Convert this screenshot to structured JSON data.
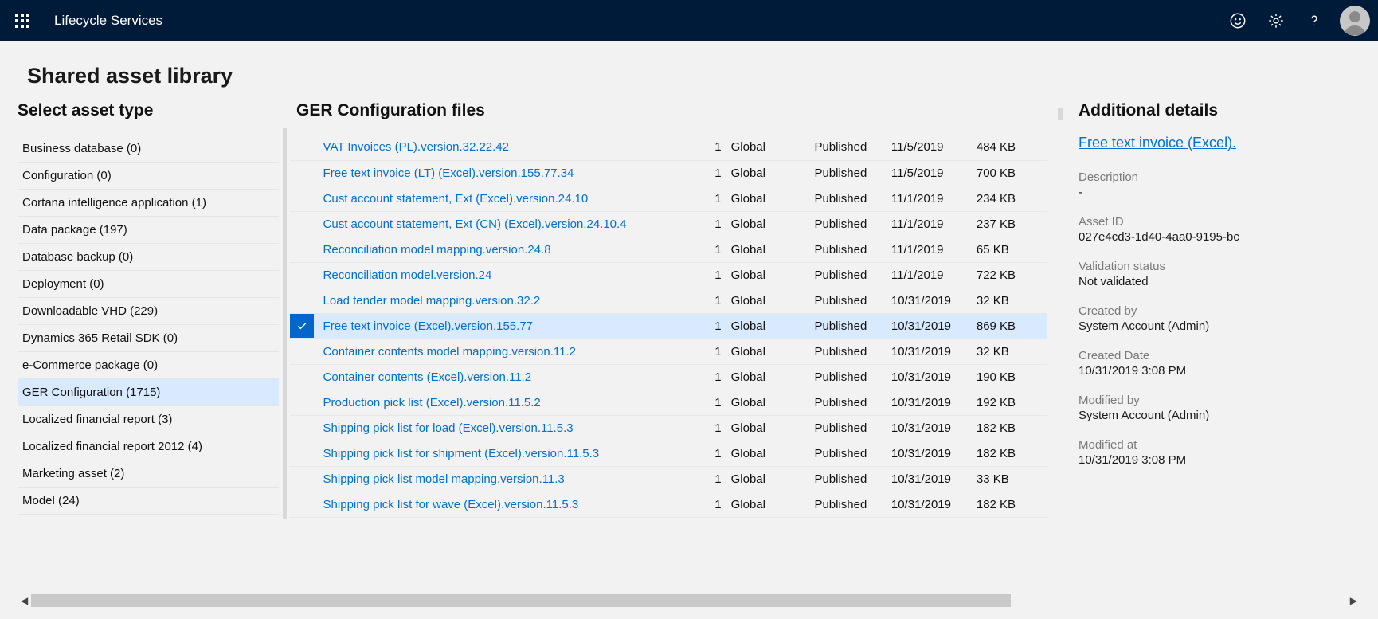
{
  "header": {
    "app_title": "Lifecycle Services"
  },
  "page_title": "Shared asset library",
  "sidebar": {
    "title": "Select asset type",
    "items": [
      {
        "label": "Business database (0)",
        "selected": false
      },
      {
        "label": "Configuration (0)",
        "selected": false
      },
      {
        "label": "Cortana intelligence application (1)",
        "selected": false
      },
      {
        "label": "Data package (197)",
        "selected": false
      },
      {
        "label": "Database backup (0)",
        "selected": false
      },
      {
        "label": "Deployment (0)",
        "selected": false
      },
      {
        "label": "Downloadable VHD (229)",
        "selected": false
      },
      {
        "label": "Dynamics 365 Retail SDK (0)",
        "selected": false
      },
      {
        "label": "e-Commerce package (0)",
        "selected": false
      },
      {
        "label": "GER Configuration (1715)",
        "selected": true
      },
      {
        "label": "Localized financial report (3)",
        "selected": false
      },
      {
        "label": "Localized financial report 2012 (4)",
        "selected": false
      },
      {
        "label": "Marketing asset (2)",
        "selected": false
      },
      {
        "label": "Model (24)",
        "selected": false
      }
    ]
  },
  "main": {
    "title": "GER Configuration files",
    "rows": [
      {
        "name": "VAT Invoices (PL).version.32.22.42",
        "count": "1",
        "scope": "Global",
        "status": "Published",
        "date": "11/5/2019",
        "size": "484 KB",
        "selected": false
      },
      {
        "name": "Free text invoice (LT) (Excel).version.155.77.34",
        "count": "1",
        "scope": "Global",
        "status": "Published",
        "date": "11/5/2019",
        "size": "700 KB",
        "selected": false
      },
      {
        "name": "Cust account statement, Ext (Excel).version.24.10",
        "count": "1",
        "scope": "Global",
        "status": "Published",
        "date": "11/1/2019",
        "size": "234 KB",
        "selected": false
      },
      {
        "name": "Cust account statement, Ext (CN) (Excel).version.24.10.4",
        "count": "1",
        "scope": "Global",
        "status": "Published",
        "date": "11/1/2019",
        "size": "237 KB",
        "selected": false
      },
      {
        "name": "Reconciliation model mapping.version.24.8",
        "count": "1",
        "scope": "Global",
        "status": "Published",
        "date": "11/1/2019",
        "size": "65 KB",
        "selected": false
      },
      {
        "name": "Reconciliation model.version.24",
        "count": "1",
        "scope": "Global",
        "status": "Published",
        "date": "11/1/2019",
        "size": "722 KB",
        "selected": false
      },
      {
        "name": "Load tender model mapping.version.32.2",
        "count": "1",
        "scope": "Global",
        "status": "Published",
        "date": "10/31/2019",
        "size": "32 KB",
        "selected": false
      },
      {
        "name": "Free text invoice (Excel).version.155.77",
        "count": "1",
        "scope": "Global",
        "status": "Published",
        "date": "10/31/2019",
        "size": "869 KB",
        "selected": true
      },
      {
        "name": "Container contents model mapping.version.11.2",
        "count": "1",
        "scope": "Global",
        "status": "Published",
        "date": "10/31/2019",
        "size": "32 KB",
        "selected": false
      },
      {
        "name": "Container contents (Excel).version.11.2",
        "count": "1",
        "scope": "Global",
        "status": "Published",
        "date": "10/31/2019",
        "size": "190 KB",
        "selected": false
      },
      {
        "name": "Production pick list (Excel).version.11.5.2",
        "count": "1",
        "scope": "Global",
        "status": "Published",
        "date": "10/31/2019",
        "size": "192 KB",
        "selected": false
      },
      {
        "name": "Shipping pick list for load (Excel).version.11.5.3",
        "count": "1",
        "scope": "Global",
        "status": "Published",
        "date": "10/31/2019",
        "size": "182 KB",
        "selected": false
      },
      {
        "name": "Shipping pick list for shipment (Excel).version.11.5.3",
        "count": "1",
        "scope": "Global",
        "status": "Published",
        "date": "10/31/2019",
        "size": "182 KB",
        "selected": false
      },
      {
        "name": "Shipping pick list model mapping.version.11.3",
        "count": "1",
        "scope": "Global",
        "status": "Published",
        "date": "10/31/2019",
        "size": "33 KB",
        "selected": false
      },
      {
        "name": "Shipping pick list for wave (Excel).version.11.5.3",
        "count": "1",
        "scope": "Global",
        "status": "Published",
        "date": "10/31/2019",
        "size": "182 KB",
        "selected": false
      }
    ]
  },
  "details": {
    "title": "Additional details",
    "name_link": "Free text invoice (Excel).",
    "fields": {
      "description_label": "Description",
      "description_value": "-",
      "asset_id_label": "Asset ID",
      "asset_id_value": "027e4cd3-1d40-4aa0-9195-bc",
      "validation_label": "Validation status",
      "validation_value": "Not validated",
      "created_by_label": "Created by",
      "created_by_value": "System Account (Admin)",
      "created_date_label": "Created Date",
      "created_date_value": "10/31/2019 3:08 PM",
      "modified_by_label": "Modified by",
      "modified_by_value": "System Account (Admin)",
      "modified_at_label": "Modified at",
      "modified_at_value": "10/31/2019 3:08 PM"
    }
  }
}
